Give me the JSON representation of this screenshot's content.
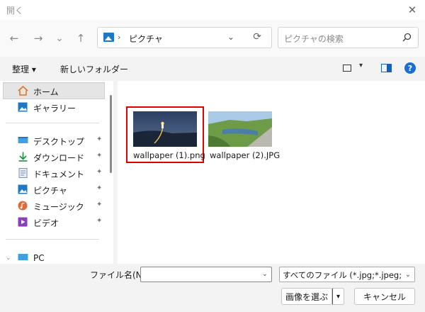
{
  "window": {
    "title": "開く",
    "close_glyph": "✕"
  },
  "nav": {
    "back_glyph": "←",
    "forward_glyph": "→",
    "recent_glyph": "⌄",
    "up_glyph": "↑",
    "address": {
      "icon": "pictures-icon",
      "separator": "›",
      "crumb": "ピクチャ",
      "dropdown_glyph": "⌄",
      "refresh_glyph": "⟳"
    },
    "search": {
      "placeholder": "ピクチャの検索",
      "icon": "search-icon"
    }
  },
  "commandbar": {
    "organize": "整理 ▾",
    "new_folder": "新しいフォルダー",
    "view_dropdown_glyph": "▾",
    "help_glyph": "?"
  },
  "sidebar": {
    "items": [
      {
        "label": "ホーム",
        "icon": "home-icon"
      },
      {
        "label": "ギャラリー",
        "icon": "gallery-icon"
      },
      {
        "label": "デスクトップ",
        "icon": "desktop-icon"
      },
      {
        "label": "ダウンロード",
        "icon": "download-icon"
      },
      {
        "label": "ドキュメント",
        "icon": "documents-icon"
      },
      {
        "label": "ピクチャ",
        "icon": "pictures-icon"
      },
      {
        "label": "ミュージック",
        "icon": "music-icon"
      },
      {
        "label": "ビデオ",
        "icon": "video-icon"
      },
      {
        "label": "PC",
        "icon": "pc-icon"
      }
    ],
    "pin_glyph": "📌",
    "expand_glyph": "⌄"
  },
  "files": [
    {
      "name": "wallpaper (1).png",
      "selected": true
    },
    {
      "name": "wallpaper (2).JPG",
      "selected": false
    }
  ],
  "bottom": {
    "filename_label": "ファイル名(N):",
    "filename_value": "",
    "filetype": "すべてのファイル (*.jpg;*.jpeg;*.bmp",
    "dropdown_glyph": "⌄",
    "open_button": "画像を選ぶ",
    "open_split_glyph": "▾",
    "cancel_button": "キャンセル"
  }
}
